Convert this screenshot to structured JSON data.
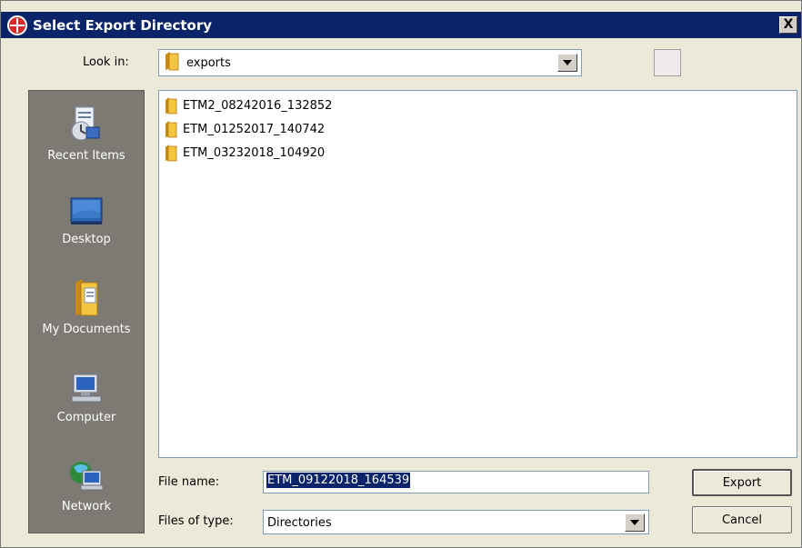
{
  "window": {
    "title": "Select Export Directory",
    "close_label": "X"
  },
  "lookin": {
    "label": "Look in:",
    "value": "exports"
  },
  "places": [
    {
      "label": "Recent Items",
      "icon": "recent-items-icon"
    },
    {
      "label": "Desktop",
      "icon": "desktop-icon"
    },
    {
      "label": "My Documents",
      "icon": "my-documents-icon"
    },
    {
      "label": "Computer",
      "icon": "computer-icon"
    },
    {
      "label": "Network",
      "icon": "network-icon"
    }
  ],
  "files": [
    {
      "name": "ETM2_08242016_132852"
    },
    {
      "name": "ETM_01252017_140742"
    },
    {
      "name": "ETM_03232018_104920"
    }
  ],
  "filename": {
    "label": "File name:",
    "value": "ETM_09122018_164539"
  },
  "filetype": {
    "label": "Files of type:",
    "value": "Directories"
  },
  "buttons": {
    "export": "Export",
    "cancel": "Cancel"
  },
  "colors": {
    "titlebar": "#0a246a",
    "places_bg": "#7d7a74",
    "folder": "#e8b020"
  }
}
